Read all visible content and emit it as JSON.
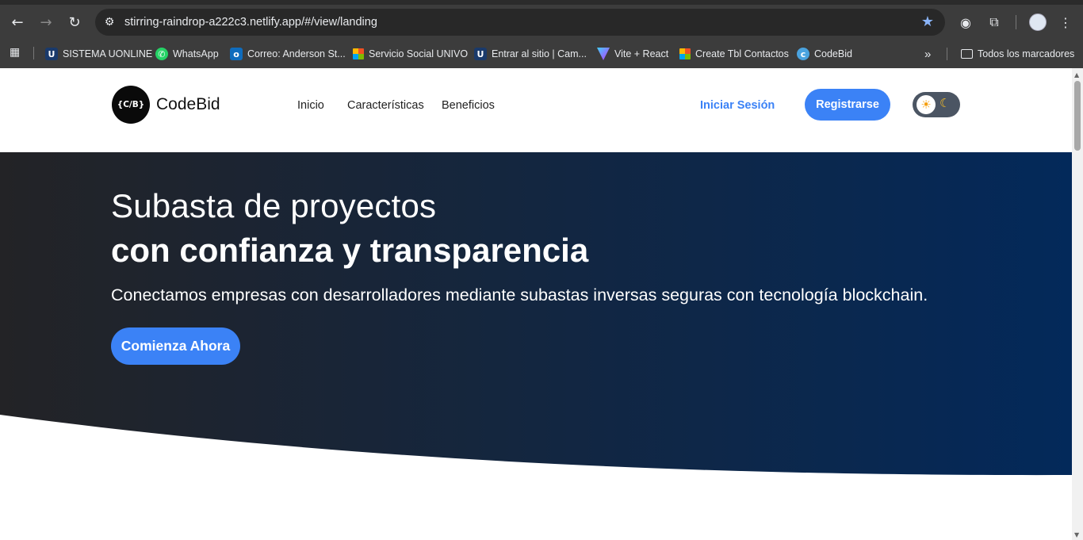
{
  "browser": {
    "url": "stirring-raindrop-a222c3.netlify.app/#/view/landing",
    "bookmarks": [
      {
        "label": "SISTEMA UONLINE",
        "icon": "u-icon"
      },
      {
        "label": "WhatsApp",
        "icon": "whatsapp-icon"
      },
      {
        "label": "Correo: Anderson St...",
        "icon": "outlook-icon"
      },
      {
        "label": "Servicio Social UNIVO",
        "icon": "microsoft-icon"
      },
      {
        "label": "Entrar al sitio | Cam...",
        "icon": "u-icon"
      },
      {
        "label": "Vite + React",
        "icon": "vite-icon"
      },
      {
        "label": "Create Tbl Contactos",
        "icon": "microsoft-icon"
      },
      {
        "label": "CodeBid",
        "icon": "codebid-icon"
      }
    ],
    "all_bookmarks_label": "Todos los marcadores"
  },
  "header": {
    "logo_mark": "{C/B}",
    "brand": "CodeBid",
    "nav": [
      "Inicio",
      "Características",
      "Beneficios"
    ],
    "login": "Iniciar Sesión",
    "register": "Registrarse"
  },
  "hero": {
    "title_light": "Subasta de proyectos",
    "title_bold": "con confianza y transparencia",
    "subtitle": "Conectamos empresas con desarrolladores mediante subastas inversas seguras con tecnología blockchain.",
    "cta": "Comienza Ahora"
  },
  "colors": {
    "accent": "#3b82f6",
    "hero_start": "#232326",
    "hero_end": "#03295a"
  }
}
